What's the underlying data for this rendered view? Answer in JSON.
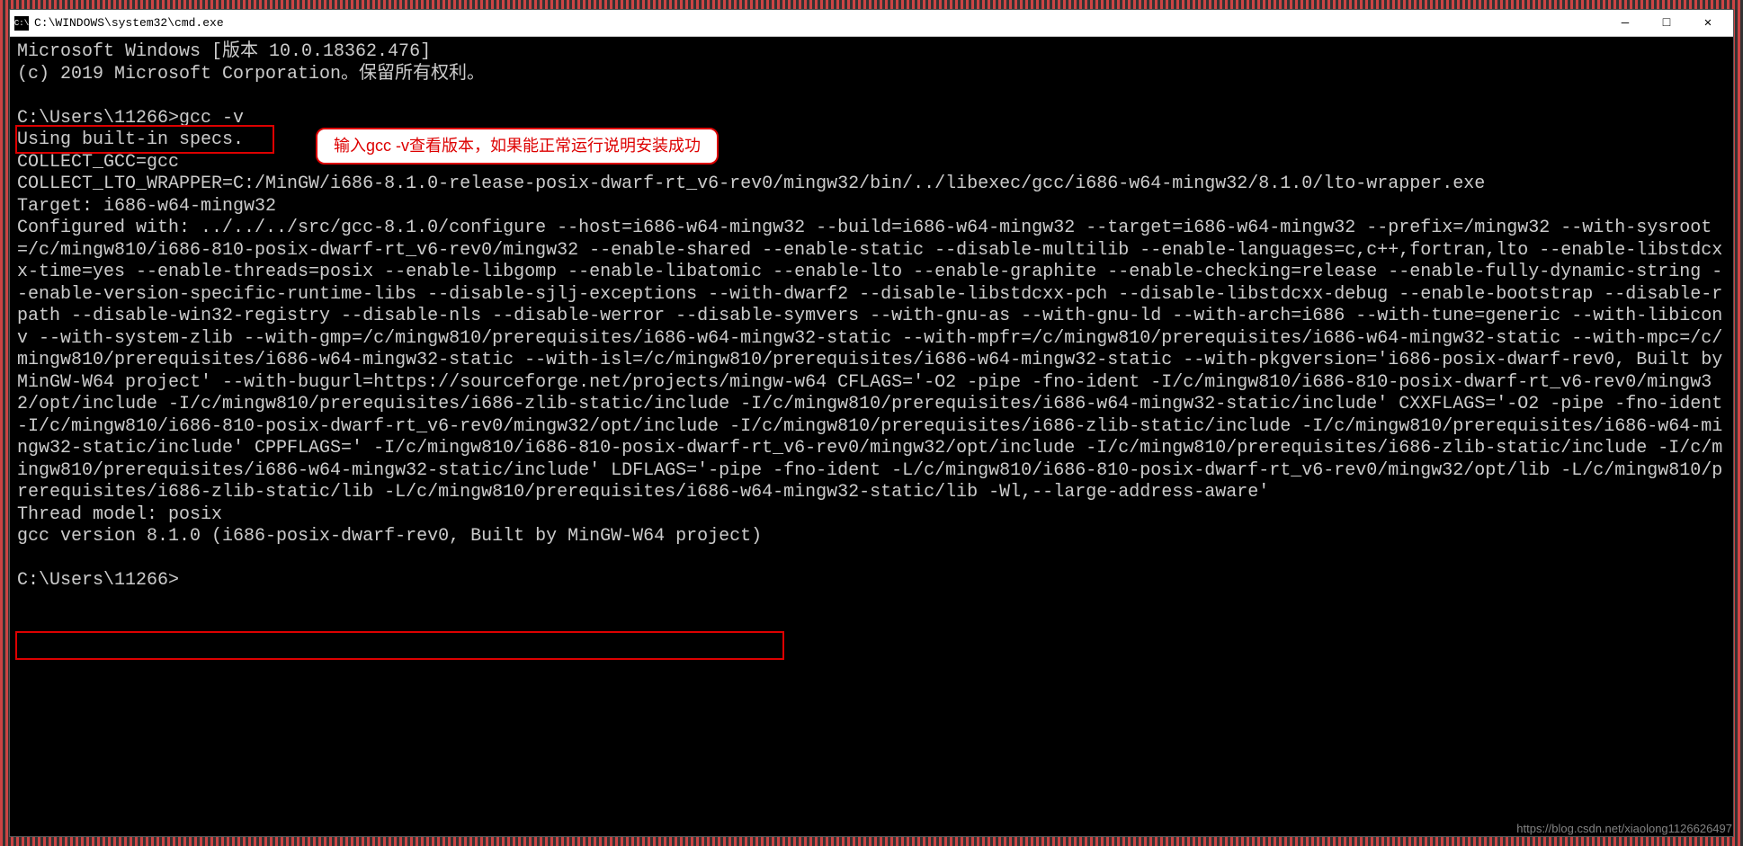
{
  "titlebar": {
    "icon_text": "C:\\",
    "title": "C:\\WINDOWS\\system32\\cmd.exe"
  },
  "window_controls": {
    "minimize": "—",
    "maximize": "□",
    "close": "✕"
  },
  "terminal": {
    "line1": "Microsoft Windows [版本 10.0.18362.476]",
    "line2": "(c) 2019 Microsoft Corporation。保留所有权利。",
    "blank1": "",
    "prompt1": "C:\\Users\\11266>gcc -v",
    "line3": "Using built-in specs.",
    "line4": "COLLECT_GCC=gcc",
    "line5": "COLLECT_LTO_WRAPPER=C:/MinGW/i686-8.1.0-release-posix-dwarf-rt_v6-rev0/mingw32/bin/../libexec/gcc/i686-w64-mingw32/8.1.0/lto-wrapper.exe",
    "line6": "Target: i686-w64-mingw32",
    "line7": "Configured with: ../../../src/gcc-8.1.0/configure --host=i686-w64-mingw32 --build=i686-w64-mingw32 --target=i686-w64-mingw32 --prefix=/mingw32 --with-sysroot=/c/mingw810/i686-810-posix-dwarf-rt_v6-rev0/mingw32 --enable-shared --enable-static --disable-multilib --enable-languages=c,c++,fortran,lto --enable-libstdcxx-time=yes --enable-threads=posix --enable-libgomp --enable-libatomic --enable-lto --enable-graphite --enable-checking=release --enable-fully-dynamic-string --enable-version-specific-runtime-libs --disable-sjlj-exceptions --with-dwarf2 --disable-libstdcxx-pch --disable-libstdcxx-debug --enable-bootstrap --disable-rpath --disable-win32-registry --disable-nls --disable-werror --disable-symvers --with-gnu-as --with-gnu-ld --with-arch=i686 --with-tune=generic --with-libiconv --with-system-zlib --with-gmp=/c/mingw810/prerequisites/i686-w64-mingw32-static --with-mpfr=/c/mingw810/prerequisites/i686-w64-mingw32-static --with-mpc=/c/mingw810/prerequisites/i686-w64-mingw32-static --with-isl=/c/mingw810/prerequisites/i686-w64-mingw32-static --with-pkgversion='i686-posix-dwarf-rev0, Built by MinGW-W64 project' --with-bugurl=https://sourceforge.net/projects/mingw-w64 CFLAGS='-O2 -pipe -fno-ident -I/c/mingw810/i686-810-posix-dwarf-rt_v6-rev0/mingw32/opt/include -I/c/mingw810/prerequisites/i686-zlib-static/include -I/c/mingw810/prerequisites/i686-w64-mingw32-static/include' CXXFLAGS='-O2 -pipe -fno-ident -I/c/mingw810/i686-810-posix-dwarf-rt_v6-rev0/mingw32/opt/include -I/c/mingw810/prerequisites/i686-zlib-static/include -I/c/mingw810/prerequisites/i686-w64-mingw32-static/include' CPPFLAGS=' -I/c/mingw810/i686-810-posix-dwarf-rt_v6-rev0/mingw32/opt/include -I/c/mingw810/prerequisites/i686-zlib-static/include -I/c/mingw810/prerequisites/i686-w64-mingw32-static/include' LDFLAGS='-pipe -fno-ident -L/c/mingw810/i686-810-posix-dwarf-rt_v6-rev0/mingw32/opt/lib -L/c/mingw810/prerequisites/i686-zlib-static/lib -L/c/mingw810/prerequisites/i686-w64-mingw32-static/lib -Wl,--large-address-aware'",
    "line8": "Thread model: posix",
    "line9": "gcc version 8.1.0 (i686-posix-dwarf-rev0, Built by MinGW-W64 project)",
    "blank2": "",
    "prompt2": "C:\\Users\\11266>"
  },
  "annotation": {
    "text": "输入gcc -v查看版本，如果能正常运行说明安装成功"
  },
  "watermark": "https://blog.csdn.net/xiaolong1126626497"
}
